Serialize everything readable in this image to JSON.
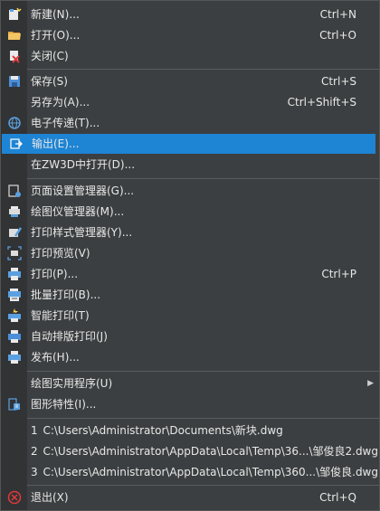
{
  "menu": {
    "items": [
      {
        "label": "新建(N)...",
        "shortcut": "Ctrl+N",
        "icon": "new-file-icon"
      },
      {
        "label": "打开(O)...",
        "shortcut": "Ctrl+O",
        "icon": "open-folder-icon"
      },
      {
        "label": "关闭(C)",
        "shortcut": "",
        "icon": "close-file-icon"
      },
      {
        "label": "保存(S)",
        "shortcut": "Ctrl+S",
        "icon": "save-icon"
      },
      {
        "label": "另存为(A)...",
        "shortcut": "Ctrl+Shift+S",
        "icon": ""
      },
      {
        "label": "电子传递(T)...",
        "shortcut": "",
        "icon": "etransmit-icon"
      },
      {
        "label": "输出(E)...",
        "shortcut": "",
        "icon": "export-icon"
      },
      {
        "label": "在ZW3D中打开(D)...",
        "shortcut": "",
        "icon": ""
      },
      {
        "label": "页面设置管理器(G)...",
        "shortcut": "",
        "icon": "page-setup-icon"
      },
      {
        "label": "绘图仪管理器(M)...",
        "shortcut": "",
        "icon": "plotter-manager-icon"
      },
      {
        "label": "打印样式管理器(Y)...",
        "shortcut": "",
        "icon": "plot-style-icon"
      },
      {
        "label": "打印预览(V)",
        "shortcut": "",
        "icon": "print-preview-icon"
      },
      {
        "label": "打印(P)...",
        "shortcut": "Ctrl+P",
        "icon": "print-icon"
      },
      {
        "label": "批量打印(B)...",
        "shortcut": "",
        "icon": "batch-print-icon"
      },
      {
        "label": "智能打印(T)",
        "shortcut": "",
        "icon": "smart-print-icon"
      },
      {
        "label": "自动排版打印(J)",
        "shortcut": "",
        "icon": "auto-layout-print-icon"
      },
      {
        "label": "发布(H)...",
        "shortcut": "",
        "icon": "publish-icon"
      },
      {
        "label": "绘图实用程序(U)",
        "shortcut": "",
        "icon": ""
      },
      {
        "label": "图形特性(I)...",
        "shortcut": "",
        "icon": "drawing-properties-icon"
      }
    ],
    "recent": [
      {
        "num": "1",
        "path": "C:\\Users\\Administrator\\Documents\\新块.dwg"
      },
      {
        "num": "2",
        "path": "C:\\Users\\Administrator\\AppData\\Local\\Temp\\36...\\邹俊良2.dwg"
      },
      {
        "num": "3",
        "path": "C:\\Users\\Administrator\\AppData\\Local\\Temp\\360...\\邹俊良.dwg"
      }
    ],
    "exit": {
      "label": "退出(X)",
      "shortcut": "Ctrl+Q",
      "icon": "exit-icon"
    }
  }
}
